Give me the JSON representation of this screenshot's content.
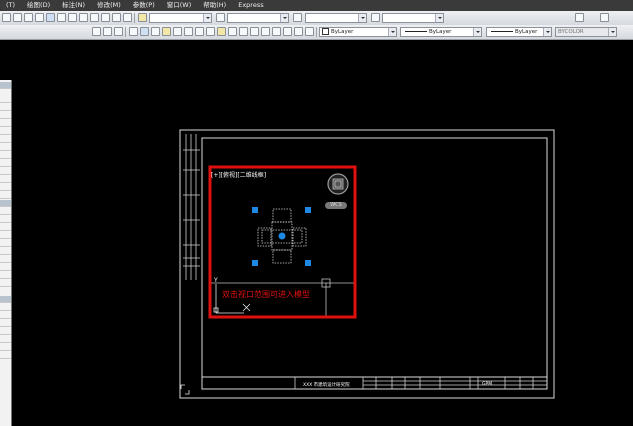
{
  "menubar": {
    "items": [
      "(T)",
      "绘图(D)",
      "标注(N)",
      "修改(M)",
      "参数(P)",
      "窗口(W)",
      "帮助(H)",
      "Express"
    ]
  },
  "toolbar": {
    "properties": {
      "layer_combo": "",
      "color_value": "ByLayer",
      "linetype_value": "ByLayer",
      "lineweight_value": "ByLayer",
      "plotstyle_value": "BYCOLOR"
    }
  },
  "viewport": {
    "label": "[+][俯视][二维线框]",
    "wcs_label": "WCS",
    "hint": "双击视口范围可进入模型"
  },
  "titleblock": {
    "drawing_name": "XXX 市建筑设计研究院",
    "sheet_code": "GPM"
  },
  "colors": {
    "viewport_border": "#e01010",
    "grip": "#1e88e5",
    "background": "#000000"
  }
}
